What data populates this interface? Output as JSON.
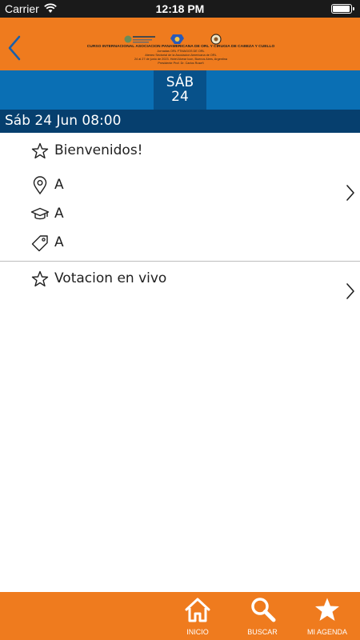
{
  "status_bar": {
    "carrier": "Carrier",
    "time": "12:18 PM",
    "battery_level": 0.95
  },
  "header": {
    "banner": {
      "title": "Curso Internacional Asociacion Panamericana de ORL y Cirugia de Cabeza y Cuello",
      "lines": [
        "Jornadas ORL FTMAGGS DE ORL",
        "Ateneo Sectorial de la Asociacion Americana de ORL",
        "24 al 27 de junio de 2023. Hotel Alvear Icon, Buenos Aires, Argentina",
        "Presidente Prof. Dr. Carlos Ruseñ"
      ]
    }
  },
  "day_tab": {
    "dow": "SÁB",
    "dom": "24"
  },
  "time_header": "Sáb 24 Jun 08:00",
  "sessions": [
    {
      "title": "Bienvenidos!",
      "location": "A",
      "speaker": "A",
      "tag": "A"
    },
    {
      "title": "Votacion en vivo"
    }
  ],
  "tab_bar": {
    "home": "INICIO",
    "search": "BUSCAR",
    "agenda": "MI AGENDA"
  },
  "colors": {
    "orange": "#ef7b1e",
    "blue": "#0a6fb4",
    "dark_blue": "#07518a",
    "navy": "#063f6e"
  }
}
